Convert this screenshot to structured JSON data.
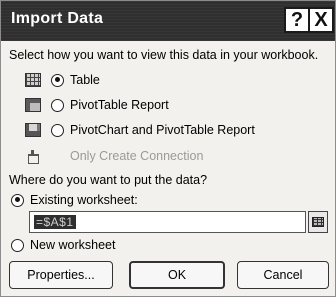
{
  "window": {
    "title": "Import Data",
    "help_glyph": "?",
    "close_glyph": "X"
  },
  "view_section": {
    "prompt": "Select how you want to view this data in your workbook.",
    "options": [
      {
        "label": "Table",
        "selected": true,
        "icon": "table-icon"
      },
      {
        "label": "PivotTable Report",
        "selected": false,
        "icon": "pivottable-icon"
      },
      {
        "label": "PivotChart and PivotTable Report",
        "selected": false,
        "icon": "pivotchart-icon"
      },
      {
        "label": "Only Create Connection",
        "selected": false,
        "disabled": true,
        "icon": "connection-icon"
      }
    ]
  },
  "location_section": {
    "prompt": "Where do you want to put the data?",
    "existing_label": "Existing worksheet:",
    "existing_selected": true,
    "existing_value": "=$A$1",
    "new_label": "New worksheet",
    "new_selected": false
  },
  "buttons": {
    "properties": "Properties...",
    "ok": "OK",
    "cancel": "Cancel"
  }
}
